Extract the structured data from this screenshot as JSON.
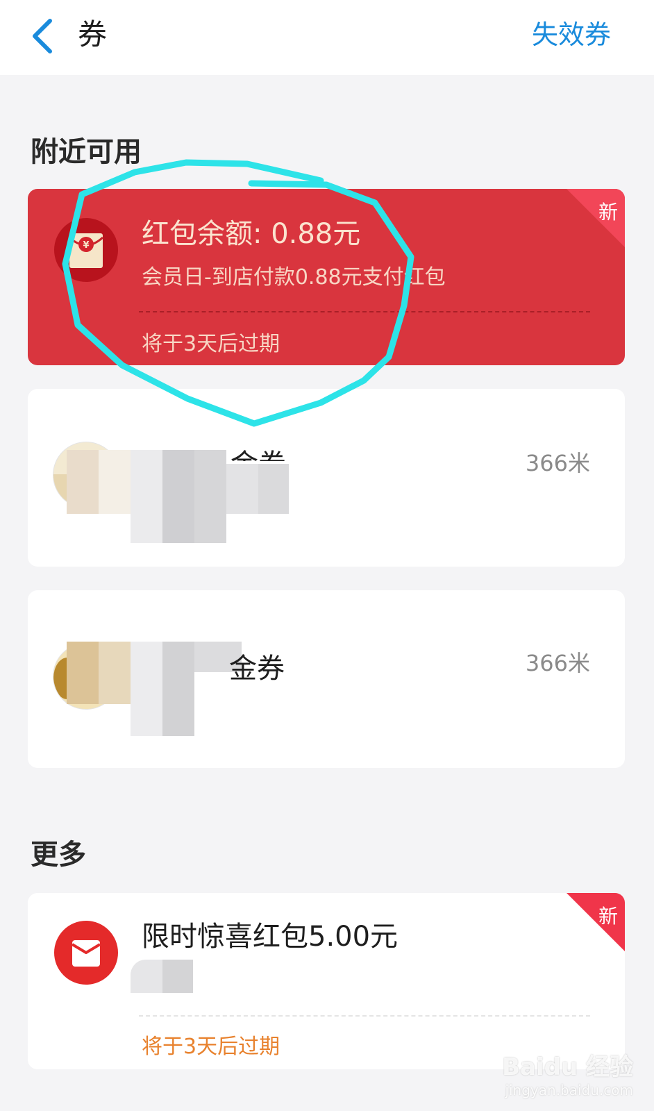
{
  "header": {
    "title": "券",
    "expired_link": "失效券"
  },
  "nearby": {
    "section_title": "附近可用",
    "red_packet": {
      "badge": "新",
      "amount_label": "红包余额: 0.88元",
      "description": "会员日-到店付款0.88元支付红包",
      "expiry": "将于3天后过期"
    },
    "coupons": [
      {
        "title_fragment": "金券",
        "distance": "366米"
      },
      {
        "title_fragment": "金券",
        "distance": "366米"
      }
    ]
  },
  "more": {
    "section_title": "更多",
    "surprise_packet": {
      "badge": "新",
      "title": "限时惊喜红包5.00元",
      "expiry": "将于3天后过期"
    }
  },
  "watermark": {
    "brand": "Baidu 经验",
    "url": "jingyan.baidu.com"
  },
  "colors": {
    "accent_blue": "#1a8bdc",
    "card_red": "#d9353e",
    "badge_red": "#f0354a",
    "highlight_cyan": "#2de3e8",
    "expiry_orange": "#e8822e"
  }
}
